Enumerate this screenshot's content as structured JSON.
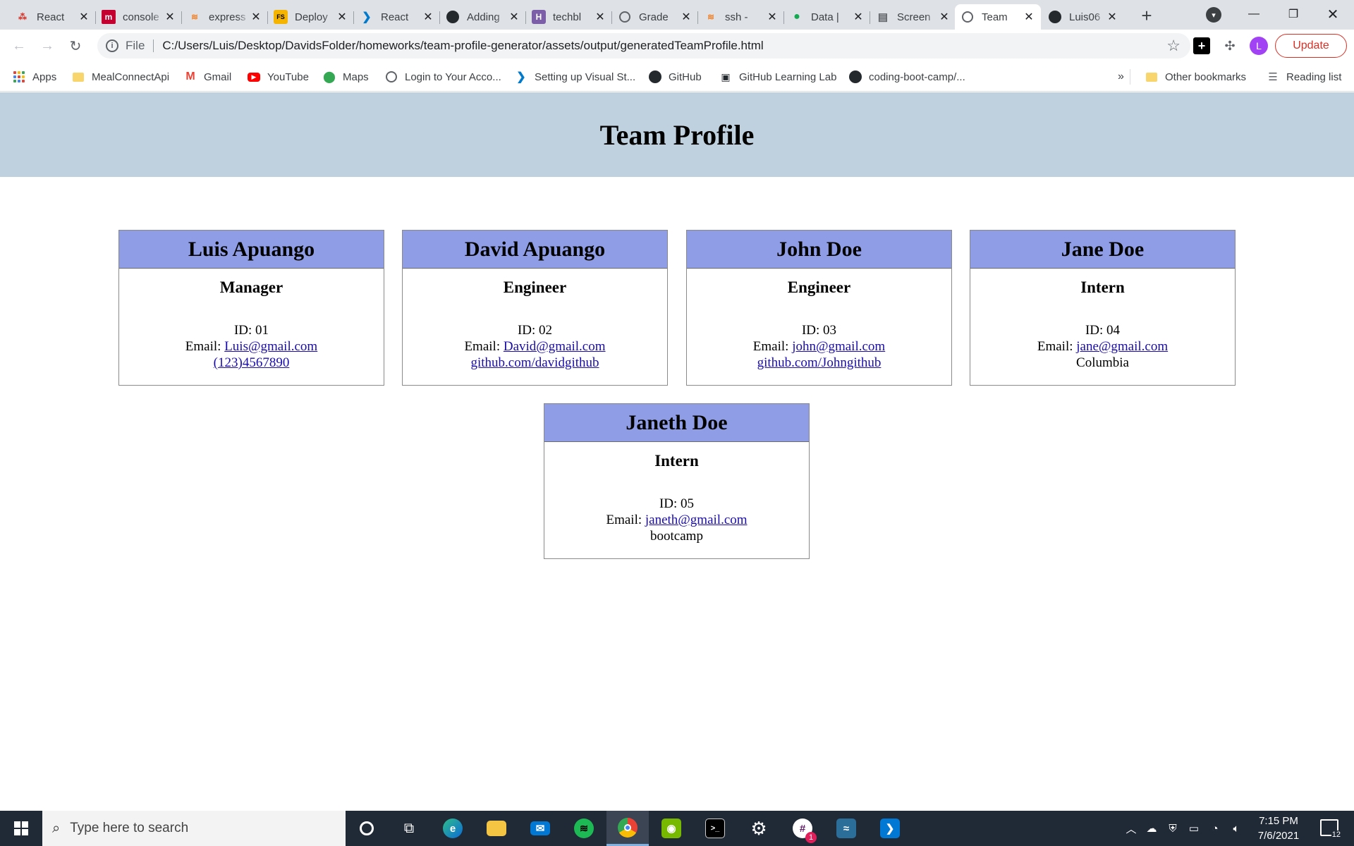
{
  "tabs": [
    {
      "title": "React",
      "icon": "react-dots-icon",
      "active": false
    },
    {
      "title": "console",
      "icon": "brand-m-icon",
      "active": false
    },
    {
      "title": "express",
      "icon": "stackoverflow-icon",
      "active": false
    },
    {
      "title": "Deploy",
      "icon": "fs-icon",
      "active": false
    },
    {
      "title": "React",
      "icon": "vscode-icon",
      "active": false
    },
    {
      "title": "Adding",
      "icon": "github-icon",
      "active": false
    },
    {
      "title": "techbl",
      "icon": "h-icon",
      "active": false
    },
    {
      "title": "Grade",
      "icon": "globe-icon",
      "active": false
    },
    {
      "title": "ssh - ",
      "icon": "stackoverflow-icon",
      "active": false
    },
    {
      "title": "Data |",
      "icon": "leaf-icon",
      "active": false
    },
    {
      "title": "Screen",
      "icon": "doc-icon",
      "active": false
    },
    {
      "title": "Team",
      "icon": "globe-icon",
      "active": true
    },
    {
      "title": "Luis06",
      "icon": "github-icon",
      "active": false
    }
  ],
  "toolbar": {
    "scheme": "File",
    "url": "C:/Users/Luis/Desktop/DavidsFolder/homeworks/team-profile-generator/assets/output/generatedTeamProfile.html",
    "profile_initial": "L",
    "update_label": "Update"
  },
  "bookmarks": [
    {
      "label": "Apps",
      "icon": "apps-grid-icon"
    },
    {
      "label": "MealConnectApi",
      "icon": "folder-icon"
    },
    {
      "label": "Gmail",
      "icon": "gmail-icon"
    },
    {
      "label": "YouTube",
      "icon": "youtube-icon"
    },
    {
      "label": "Maps",
      "icon": "maps-pin-icon"
    },
    {
      "label": "Login to Your Acco...",
      "icon": "globe-icon"
    },
    {
      "label": "Setting up Visual St...",
      "icon": "vscode-icon"
    },
    {
      "label": "GitHub",
      "icon": "github-icon"
    },
    {
      "label": "GitHub Learning Lab",
      "icon": "learning-lab-icon"
    },
    {
      "label": "coding-boot-camp/...",
      "icon": "github-icon"
    }
  ],
  "bookmarks_right": {
    "overflow": "»",
    "other": "Other bookmarks",
    "reading": "Reading list"
  },
  "page": {
    "title": "Team Profile",
    "employees": [
      {
        "name": "Luis Apuango",
        "role": "Manager",
        "id": "ID: 01",
        "email_prefix": "Email: ",
        "email": "Luis@gmail.com",
        "extra": "(123)4567890",
        "extra_is_link": true
      },
      {
        "name": "David Apuango",
        "role": "Engineer",
        "id": "ID: 02",
        "email_prefix": "Email: ",
        "email": "David@gmail.com",
        "extra": "github.com/davidgithub",
        "extra_is_link": true
      },
      {
        "name": "John Doe",
        "role": "Engineer",
        "id": "ID: 03",
        "email_prefix": "Email: ",
        "email": "john@gmail.com",
        "extra": "github.com/Johngithub",
        "extra_is_link": true
      },
      {
        "name": "Jane Doe",
        "role": "Intern",
        "id": "ID: 04",
        "email_prefix": "Email: ",
        "email": "jane@gmail.com",
        "extra": "Columbia",
        "extra_is_link": false
      },
      {
        "name": "Janeth Doe",
        "role": "Intern",
        "id": "ID: 05",
        "email_prefix": "Email: ",
        "email": "janeth@gmail.com",
        "extra": "bootcamp",
        "extra_is_link": false
      }
    ]
  },
  "taskbar": {
    "search_placeholder": "Type here to search",
    "time": "7:15 PM",
    "date": "7/6/2021",
    "slack_badge": "1",
    "notifications": "12"
  }
}
